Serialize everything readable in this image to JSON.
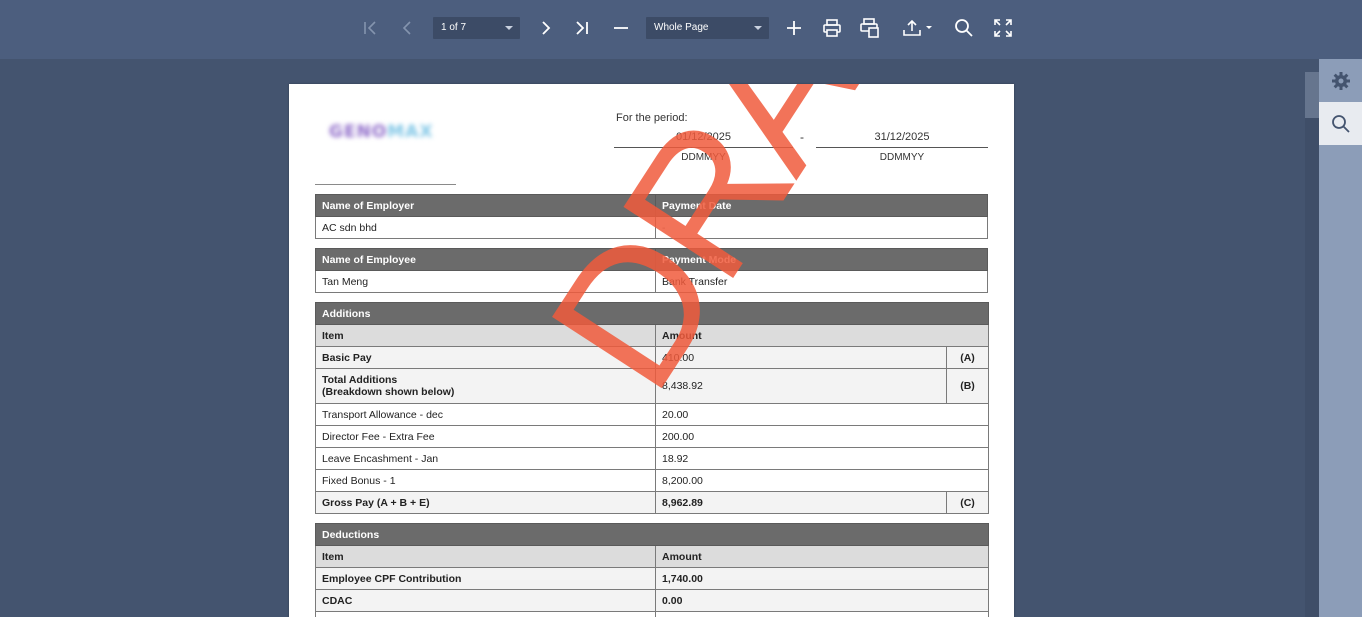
{
  "toolbar": {
    "page_indicator": "1 of 7",
    "zoom_mode": "Whole Page",
    "icons": [
      "first-page-icon",
      "previous-page-icon",
      "next-page-icon",
      "last-page-icon",
      "zoom-out-icon",
      "zoom-in-icon",
      "print-icon",
      "print-page-icon",
      "export-icon",
      "search-icon",
      "fullscreen-icon"
    ]
  },
  "side_panel": {
    "icons": [
      "gear-icon",
      "search-icon"
    ]
  },
  "document": {
    "logo_text_1": "GENO",
    "logo_text_2": "MAX",
    "period_label": "For the period:",
    "date_from": "01/12/2025",
    "date_to": "31/12/2025",
    "date_separator": "-",
    "date_format_from": "DDMMYY",
    "date_format_to": "DDMMYY",
    "employer": {
      "header_name": "Name of Employer",
      "header_date": "Payment Date",
      "name": "AC sdn bhd",
      "date": "-"
    },
    "employee": {
      "header_name": "Name of Employee",
      "header_mode": "Payment Mode",
      "name": "Tan Meng",
      "mode": "Bank Transfer"
    },
    "additions": {
      "title": "Additions",
      "col_item": "Item",
      "col_amount": "Amount",
      "basic_pay": {
        "item": "Basic Pay",
        "amount": "410.00",
        "code": "(A)"
      },
      "total_additions": {
        "item_line1": "Total Additions",
        "item_line2": "(Breakdown shown below)",
        "amount": "8,438.92",
        "code": "(B)"
      },
      "breakdown": [
        {
          "item": "Transport Allowance - dec",
          "amount": "20.00"
        },
        {
          "item": "Director Fee - Extra Fee",
          "amount": "200.00"
        },
        {
          "item": "Leave Encashment - Jan",
          "amount": "18.92"
        },
        {
          "item": "Fixed Bonus - 1",
          "amount": "8,200.00"
        }
      ],
      "gross_pay": {
        "item": "Gross Pay (A + B + E)",
        "amount": "8,962.89",
        "code": "(C)"
      }
    },
    "deductions": {
      "title": "Deductions",
      "col_item": "Item",
      "col_amount": "Amount",
      "rows": [
        {
          "item": "Employee CPF Contribution",
          "amount": "1,740.00"
        },
        {
          "item": "CDAC",
          "amount": "0.00"
        }
      ]
    },
    "watermark": "DRAFT"
  },
  "colors": {
    "toolbar_bg": "#4c5e7e",
    "viewer_bg": "#44546f",
    "table_header_bg": "#6b6b6b",
    "table_subheader_bg": "#dcdcdc",
    "watermark": "#f05a3c"
  }
}
